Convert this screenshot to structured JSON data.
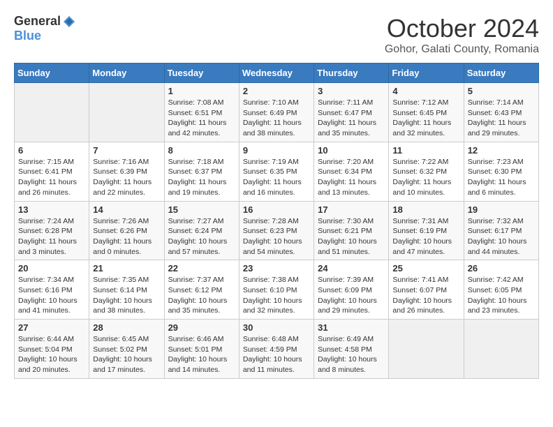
{
  "header": {
    "logo": {
      "general": "General",
      "blue": "Blue"
    },
    "title": "October 2024",
    "subtitle": "Gohor, Galati County, Romania"
  },
  "weekdays": [
    "Sunday",
    "Monday",
    "Tuesday",
    "Wednesday",
    "Thursday",
    "Friday",
    "Saturday"
  ],
  "weeks": [
    [
      {
        "day": null
      },
      {
        "day": null
      },
      {
        "day": "1",
        "sunrise": "7:08 AM",
        "sunset": "6:51 PM",
        "daylight": "11 hours and 42 minutes."
      },
      {
        "day": "2",
        "sunrise": "7:10 AM",
        "sunset": "6:49 PM",
        "daylight": "11 hours and 38 minutes."
      },
      {
        "day": "3",
        "sunrise": "7:11 AM",
        "sunset": "6:47 PM",
        "daylight": "11 hours and 35 minutes."
      },
      {
        "day": "4",
        "sunrise": "7:12 AM",
        "sunset": "6:45 PM",
        "daylight": "11 hours and 32 minutes."
      },
      {
        "day": "5",
        "sunrise": "7:14 AM",
        "sunset": "6:43 PM",
        "daylight": "11 hours and 29 minutes."
      }
    ],
    [
      {
        "day": "6",
        "sunrise": "7:15 AM",
        "sunset": "6:41 PM",
        "daylight": "11 hours and 26 minutes."
      },
      {
        "day": "7",
        "sunrise": "7:16 AM",
        "sunset": "6:39 PM",
        "daylight": "11 hours and 22 minutes."
      },
      {
        "day": "8",
        "sunrise": "7:18 AM",
        "sunset": "6:37 PM",
        "daylight": "11 hours and 19 minutes."
      },
      {
        "day": "9",
        "sunrise": "7:19 AM",
        "sunset": "6:35 PM",
        "daylight": "11 hours and 16 minutes."
      },
      {
        "day": "10",
        "sunrise": "7:20 AM",
        "sunset": "6:34 PM",
        "daylight": "11 hours and 13 minutes."
      },
      {
        "day": "11",
        "sunrise": "7:22 AM",
        "sunset": "6:32 PM",
        "daylight": "11 hours and 10 minutes."
      },
      {
        "day": "12",
        "sunrise": "7:23 AM",
        "sunset": "6:30 PM",
        "daylight": "11 hours and 6 minutes."
      }
    ],
    [
      {
        "day": "13",
        "sunrise": "7:24 AM",
        "sunset": "6:28 PM",
        "daylight": "11 hours and 3 minutes."
      },
      {
        "day": "14",
        "sunrise": "7:26 AM",
        "sunset": "6:26 PM",
        "daylight": "11 hours and 0 minutes."
      },
      {
        "day": "15",
        "sunrise": "7:27 AM",
        "sunset": "6:24 PM",
        "daylight": "10 hours and 57 minutes."
      },
      {
        "day": "16",
        "sunrise": "7:28 AM",
        "sunset": "6:23 PM",
        "daylight": "10 hours and 54 minutes."
      },
      {
        "day": "17",
        "sunrise": "7:30 AM",
        "sunset": "6:21 PM",
        "daylight": "10 hours and 51 minutes."
      },
      {
        "day": "18",
        "sunrise": "7:31 AM",
        "sunset": "6:19 PM",
        "daylight": "10 hours and 47 minutes."
      },
      {
        "day": "19",
        "sunrise": "7:32 AM",
        "sunset": "6:17 PM",
        "daylight": "10 hours and 44 minutes."
      }
    ],
    [
      {
        "day": "20",
        "sunrise": "7:34 AM",
        "sunset": "6:16 PM",
        "daylight": "10 hours and 41 minutes."
      },
      {
        "day": "21",
        "sunrise": "7:35 AM",
        "sunset": "6:14 PM",
        "daylight": "10 hours and 38 minutes."
      },
      {
        "day": "22",
        "sunrise": "7:37 AM",
        "sunset": "6:12 PM",
        "daylight": "10 hours and 35 minutes."
      },
      {
        "day": "23",
        "sunrise": "7:38 AM",
        "sunset": "6:10 PM",
        "daylight": "10 hours and 32 minutes."
      },
      {
        "day": "24",
        "sunrise": "7:39 AM",
        "sunset": "6:09 PM",
        "daylight": "10 hours and 29 minutes."
      },
      {
        "day": "25",
        "sunrise": "7:41 AM",
        "sunset": "6:07 PM",
        "daylight": "10 hours and 26 minutes."
      },
      {
        "day": "26",
        "sunrise": "7:42 AM",
        "sunset": "6:05 PM",
        "daylight": "10 hours and 23 minutes."
      }
    ],
    [
      {
        "day": "27",
        "sunrise": "6:44 AM",
        "sunset": "5:04 PM",
        "daylight": "10 hours and 20 minutes."
      },
      {
        "day": "28",
        "sunrise": "6:45 AM",
        "sunset": "5:02 PM",
        "daylight": "10 hours and 17 minutes."
      },
      {
        "day": "29",
        "sunrise": "6:46 AM",
        "sunset": "5:01 PM",
        "daylight": "10 hours and 14 minutes."
      },
      {
        "day": "30",
        "sunrise": "6:48 AM",
        "sunset": "4:59 PM",
        "daylight": "10 hours and 11 minutes."
      },
      {
        "day": "31",
        "sunrise": "6:49 AM",
        "sunset": "4:58 PM",
        "daylight": "10 hours and 8 minutes."
      },
      {
        "day": null
      },
      {
        "day": null
      }
    ]
  ]
}
